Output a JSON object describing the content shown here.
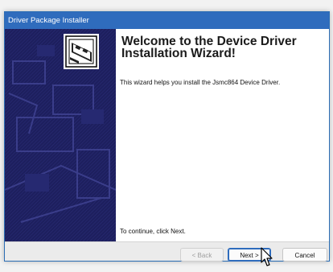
{
  "window": {
    "title": "Driver Package Installer"
  },
  "main": {
    "heading": "Welcome to the Device Driver Installation Wizard!",
    "intro": "This wizard helps you install the Jsmc864 Device Driver.",
    "continue_hint": "To continue, click Next."
  },
  "footer": {
    "back_label": "< Back",
    "next_label": "Next >",
    "cancel_label": "Cancel"
  },
  "colors": {
    "title_bar": "#2f6cbd",
    "side_panel": "#1d1f5e"
  },
  "icons": {
    "wizard": "driver-install-icon",
    "cursor": "mouse-pointer-icon"
  }
}
